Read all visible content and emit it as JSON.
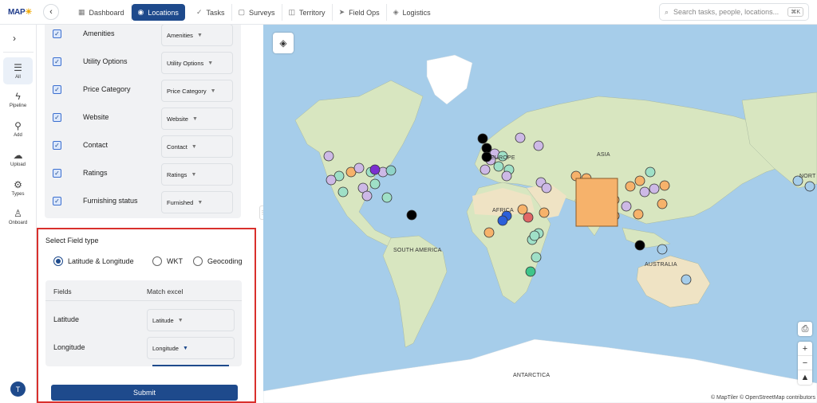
{
  "app": {
    "logo_main": "MAP",
    "logo_accent": "☀"
  },
  "nav": [
    {
      "label": "Dashboard",
      "icon": "dashboard-icon"
    },
    {
      "label": "Locations",
      "icon": "location-pin-icon",
      "active": true
    },
    {
      "label": "Tasks",
      "icon": "tasks-icon"
    },
    {
      "label": "Surveys",
      "icon": "surveys-icon"
    },
    {
      "label": "Territory",
      "icon": "territory-icon"
    },
    {
      "label": "Field Ops",
      "icon": "field-ops-icon"
    },
    {
      "label": "Logistics",
      "icon": "logistics-icon"
    }
  ],
  "search": {
    "placeholder": "Search tasks, people, locations...",
    "shortcut": "⌘K"
  },
  "rail": [
    {
      "label": "All",
      "icon": "list-icon",
      "active": true
    },
    {
      "label": "Pipeline",
      "icon": "bolt-icon"
    },
    {
      "label": "Add",
      "icon": "pin-icon"
    },
    {
      "label": "Upload",
      "icon": "cloud-upload-icon"
    },
    {
      "label": "Types",
      "icon": "gear-icon"
    },
    {
      "label": "Onboard",
      "icon": "user-icon"
    }
  ],
  "user": {
    "avatar_initial": "T"
  },
  "mapping_rows": [
    {
      "label": "Amenities",
      "value": "Amenities",
      "checked": true
    },
    {
      "label": "Utility Options",
      "value": "Utility Options",
      "checked": true
    },
    {
      "label": "Price Category",
      "value": "Price Category",
      "checked": true
    },
    {
      "label": "Website",
      "value": "Website",
      "checked": true
    },
    {
      "label": "Contact",
      "value": "Contact",
      "checked": true
    },
    {
      "label": "Ratings",
      "value": "Ratings",
      "checked": true
    },
    {
      "label": "Furnishing status",
      "value": "Furnished",
      "checked": true
    }
  ],
  "field_type": {
    "title": "Select Field type",
    "options": [
      "Latitude & Longitude",
      "WKT",
      "Geocoding"
    ],
    "selected": "Latitude & Longitude",
    "fields_header": "Fields",
    "match_header": "Match excel",
    "rows": [
      {
        "label": "Latitude",
        "value": "Latitude"
      },
      {
        "label": "Longitude",
        "value": "Longitude"
      }
    ],
    "submit_label": "Submit"
  },
  "map": {
    "labels": [
      "ASIA",
      "EUROPE",
      "AFRICA",
      "SOUTH AMERICA",
      "AUSTRALIA",
      "ANTARCTICA",
      "NORT"
    ],
    "attribution": "© MapTiler © OpenStreetMap contributors",
    "colors": {
      "water": "#a6cdea",
      "land": "#d8e6c0",
      "desert": "#efe3c4",
      "ice": "#ffffff"
    }
  }
}
